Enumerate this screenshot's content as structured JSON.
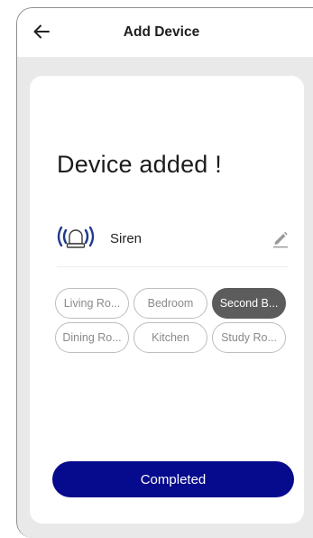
{
  "header": {
    "title": "Add Device",
    "back_icon": "arrow-left-icon"
  },
  "main": {
    "success_message": "Device added !",
    "device": {
      "icon": "siren-icon",
      "name": "Siren",
      "edit_icon": "pencil-icon"
    },
    "rooms": [
      {
        "label": "Living Ro...",
        "selected": false
      },
      {
        "label": "Bedroom",
        "selected": false
      },
      {
        "label": "Second B...",
        "selected": true
      },
      {
        "label": "Dining Ro...",
        "selected": false
      },
      {
        "label": "Kitchen",
        "selected": false
      },
      {
        "label": "Study Ro...",
        "selected": false
      }
    ],
    "complete_label": "Completed"
  },
  "colors": {
    "primary_button": "#060a8c",
    "selected_chip": "#5c5c5c",
    "siren_icon": "#1f3a8a",
    "background": "#e9e9e9"
  }
}
